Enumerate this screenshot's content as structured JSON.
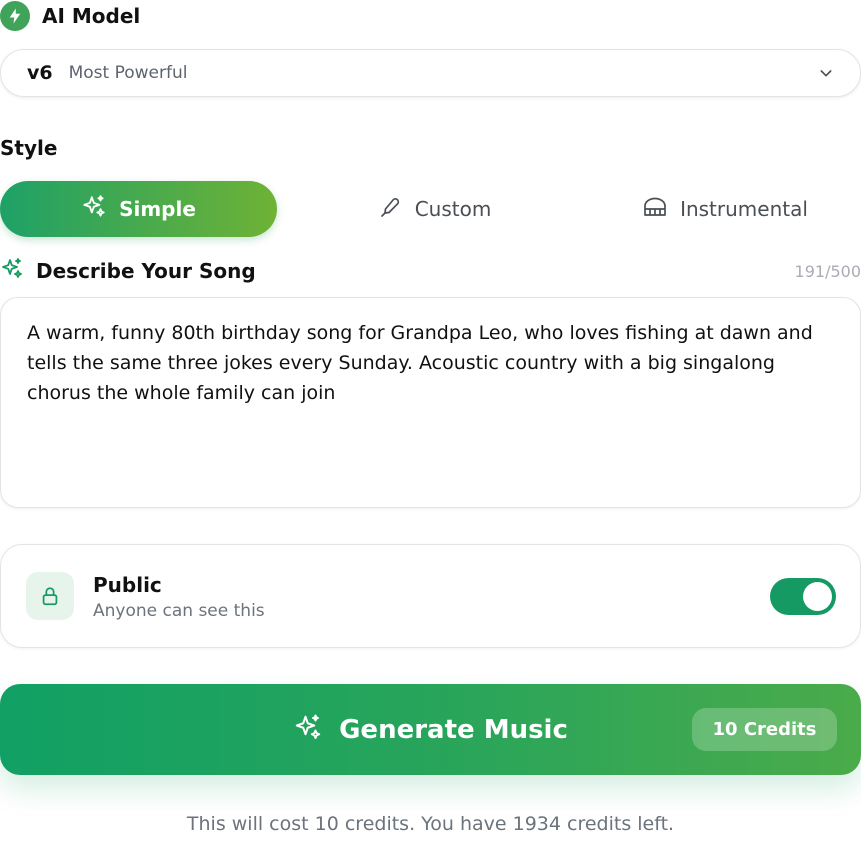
{
  "model": {
    "header_label": "AI Model",
    "version": "v6",
    "description": "Most Powerful",
    "icons": {
      "header": "bolt-icon",
      "dropdown": "chevron-down-icon"
    }
  },
  "style": {
    "label": "Style",
    "tabs": [
      {
        "label": "Simple",
        "icon": "sparkles-icon",
        "active": true
      },
      {
        "label": "Custom",
        "icon": "pen-icon",
        "active": false
      },
      {
        "label": "Instrumental",
        "icon": "piano-icon",
        "active": false
      }
    ]
  },
  "describe": {
    "label": "Describe Your Song",
    "char_count": "191/500",
    "text": "A warm, funny 80th birthday song for Grandpa Leo, who loves fishing at dawn and tells the same three jokes every Sunday. Acoustic country with a big singalong chorus the whole family can join",
    "icon": "sparkles-icon"
  },
  "visibility": {
    "title": "Public",
    "subtitle": "Anyone can see this",
    "enabled": true,
    "icon": "lock-icon"
  },
  "generate": {
    "label": "Generate Music",
    "credits_badge": "10 Credits",
    "icon": "sparkles-icon"
  },
  "cost_note": "This will cost 10 credits. You have 1934 credits left.",
  "colors": {
    "accent_green": "#169a63",
    "gradient_start": "#1ea167",
    "gradient_end": "#6fb235",
    "muted_text": "#6b737c"
  }
}
